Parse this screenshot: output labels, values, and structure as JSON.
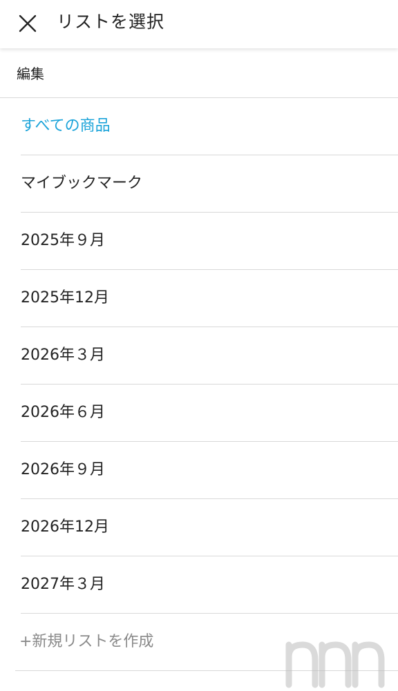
{
  "header": {
    "title": "リストを選択",
    "close_icon": "close-icon"
  },
  "edit": {
    "label": "編集"
  },
  "lists": [
    {
      "label": "すべての商品",
      "selected": true
    },
    {
      "label": "マイブックマーク",
      "selected": false
    },
    {
      "label": "2025年９月",
      "selected": false
    },
    {
      "label": "2025年12月",
      "selected": false
    },
    {
      "label": "2026年３月",
      "selected": false
    },
    {
      "label": "2026年６月",
      "selected": false
    },
    {
      "label": "2026年９月",
      "selected": false
    },
    {
      "label": "2026年12月",
      "selected": false
    },
    {
      "label": "2027年３月",
      "selected": false
    }
  ],
  "new_list": {
    "label": "+新規リストを作成"
  },
  "colors": {
    "accent": "#1aa3d9",
    "text": "#222222",
    "muted": "#8a8a8a",
    "divider": "#d8d8d8"
  }
}
